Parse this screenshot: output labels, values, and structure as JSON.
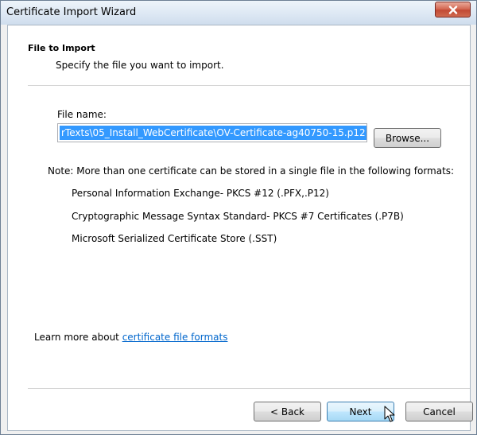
{
  "window": {
    "title": "Certificate Import Wizard",
    "close_icon": "close-icon"
  },
  "header": {
    "title": "File to Import",
    "subtitle": "Specify the file you want to import."
  },
  "file": {
    "label": "File name:",
    "value": "rTexts\\05_Install_WebCertificate\\OV-Certificate-ag40750-15.p12",
    "browse_label": "Browse..."
  },
  "note": {
    "text": "Note: More than one certificate can be stored in a single file in the following formats:",
    "formats": [
      "Personal Information Exchange- PKCS #12 (.PFX,.P12)",
      "Cryptographic Message Syntax Standard- PKCS #7 Certificates (.P7B)",
      "Microsoft Serialized Certificate Store (.SST)"
    ]
  },
  "learn_more": {
    "prefix": "Learn more about ",
    "link": "certificate file formats"
  },
  "buttons": {
    "back": "< Back",
    "next": "Next",
    "cancel": "Cancel"
  },
  "colors": {
    "selection": "#3399ff",
    "link": "#0066cc",
    "close_button": "#c24a34"
  }
}
